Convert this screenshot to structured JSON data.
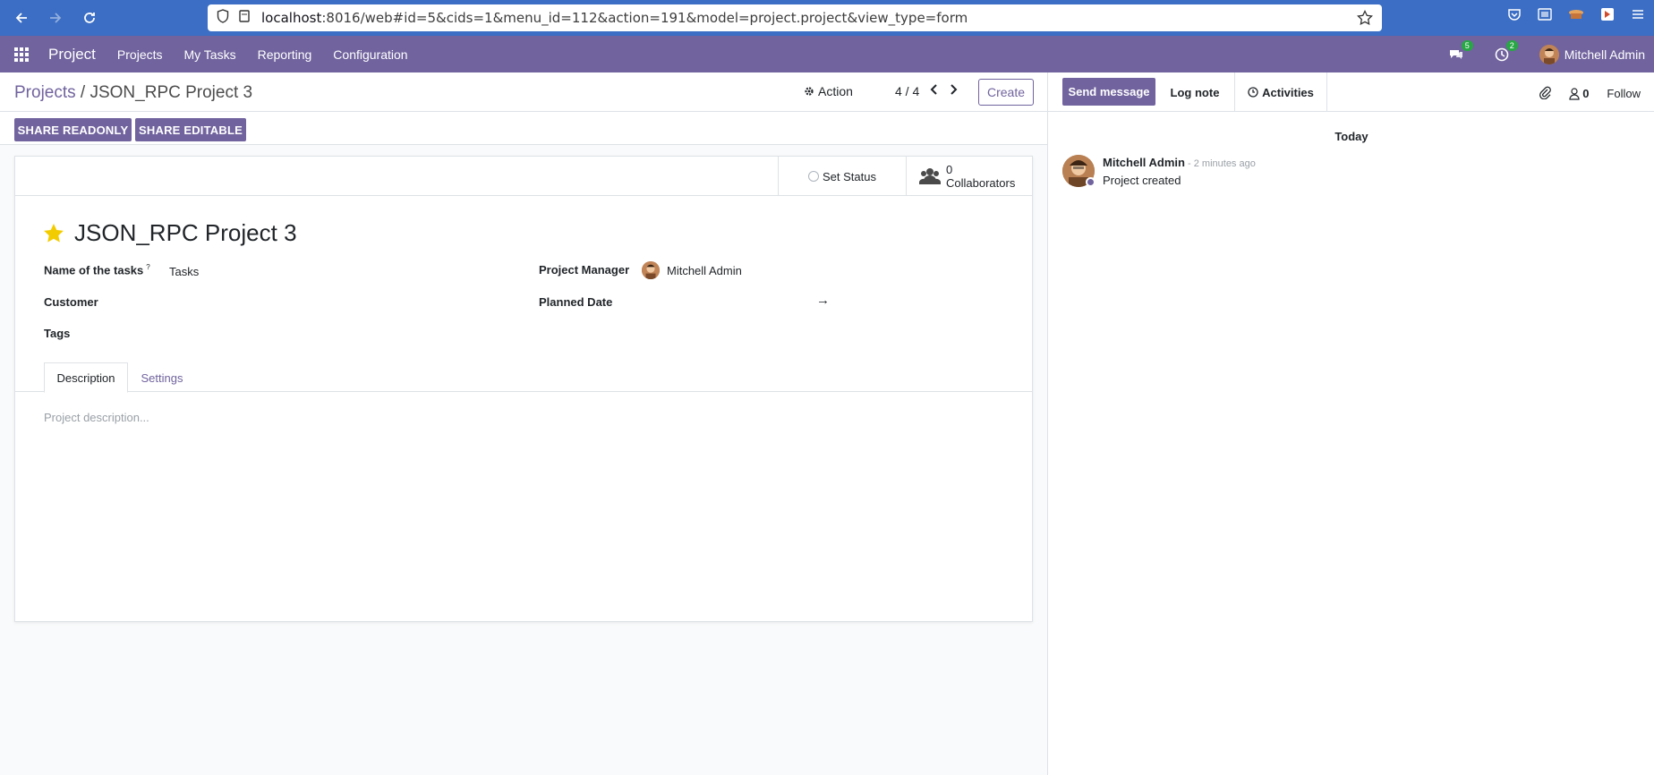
{
  "browser": {
    "url_host": "localhost",
    "url_rest": ":8016/web#id=5&cids=1&menu_id=112&action=191&model=project.project&view_type=form"
  },
  "navbar": {
    "brand": "Project",
    "menu": [
      "Projects",
      "My Tasks",
      "Reporting",
      "Configuration"
    ],
    "messages_badge": "5",
    "activities_badge": "2",
    "user_name": "Mitchell Admin"
  },
  "control_panel": {
    "breadcrumb_parent": "Projects",
    "breadcrumb_sep": " / ",
    "breadcrumb_current": "JSON_RPC Project 3",
    "action_label": "Action",
    "pager": "4 / 4",
    "create_label": "Create"
  },
  "share": {
    "readonly_label": "SHARE READONLY",
    "editable_label": "SHARE EDITABLE"
  },
  "form": {
    "set_status_label": "Set Status",
    "collaborators_count": "0",
    "collaborators_label": "Collaborators",
    "title": "JSON_RPC Project 3",
    "fields": {
      "tasks_name_label": "Name of the tasks",
      "tasks_name_help": "?",
      "tasks_name_value": "Tasks",
      "customer_label": "Customer",
      "tags_label": "Tags",
      "manager_label": "Project Manager",
      "manager_value": "Mitchell Admin",
      "planned_date_label": "Planned Date",
      "planned_date_arrow": "→"
    },
    "tabs": [
      "Description",
      "Settings"
    ],
    "description_placeholder": "Project description..."
  },
  "chatter": {
    "send_message_label": "Send message",
    "log_note_label": "Log note",
    "activities_label": "Activities",
    "followers_count": "0",
    "follow_label": "Follow",
    "today_label": "Today",
    "message": {
      "author": "Mitchell Admin",
      "date": " - 2 minutes ago",
      "body": "Project created"
    }
  },
  "colors": {
    "browser_bar": "#3b6ec4",
    "odoo_primary": "#71639e",
    "badge_green": "#28a745"
  }
}
